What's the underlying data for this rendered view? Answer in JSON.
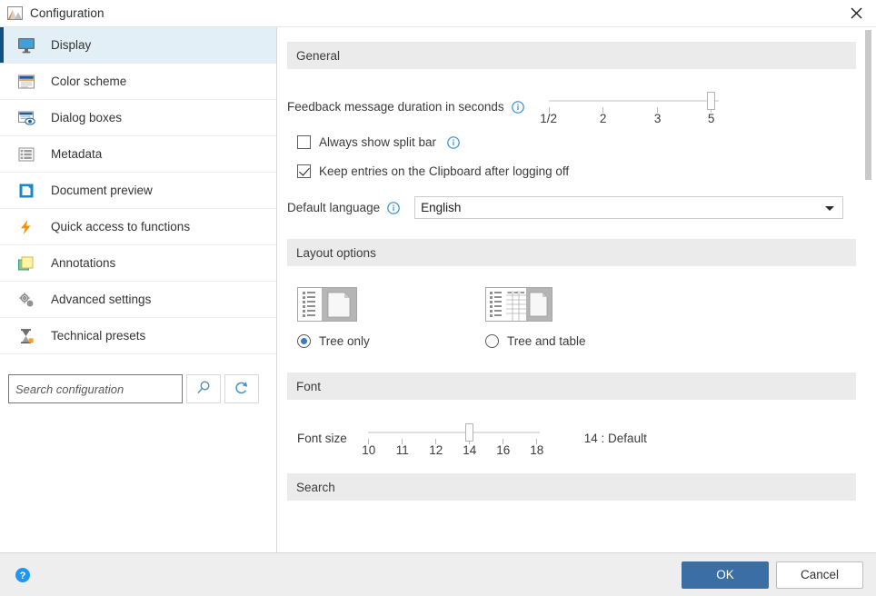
{
  "window": {
    "title": "Configuration",
    "icon": "app-image-icon",
    "close_label": "✕"
  },
  "sidebar": {
    "items": [
      {
        "label": "Display",
        "icon": "monitor-icon",
        "selected": true
      },
      {
        "label": "Color scheme",
        "icon": "color-scheme-icon",
        "selected": false
      },
      {
        "label": "Dialog boxes",
        "icon": "dialog-box-icon",
        "selected": false
      },
      {
        "label": "Metadata",
        "icon": "metadata-table-icon",
        "selected": false
      },
      {
        "label": "Document preview",
        "icon": "document-icon",
        "selected": false
      },
      {
        "label": "Quick access to functions",
        "icon": "lightning-bolt-icon",
        "selected": false
      },
      {
        "label": "Annotations",
        "icon": "sticky-notes-icon",
        "selected": false
      },
      {
        "label": "Advanced settings",
        "icon": "gears-icon",
        "selected": false
      },
      {
        "label": "Technical presets",
        "icon": "hourglass-icon",
        "selected": false
      }
    ],
    "search": {
      "placeholder": "Search configuration",
      "value": "",
      "search_icon": "magnifier-icon",
      "reset_icon": "refresh-icon"
    }
  },
  "content": {
    "sections": {
      "general": {
        "title": "General",
        "feedback_slider": {
          "label": "Feedback message duration in seconds",
          "info_icon": "info-icon",
          "ticks": [
            "1/2",
            "2",
            "3",
            "5"
          ],
          "value": "5",
          "value_index": 3
        },
        "split_bar": {
          "label": "Always show split bar",
          "checked": false,
          "info_icon": "info-icon"
        },
        "clipboard": {
          "label": "Keep entries on the Clipboard after logging off",
          "checked": true
        },
        "language": {
          "label": "Default language",
          "info_icon": "info-icon",
          "value": "English",
          "options": [
            "English"
          ]
        }
      },
      "layout": {
        "title": "Layout options",
        "options": [
          {
            "label": "Tree only",
            "selected": true,
            "preview": "tree-only-preview-icon"
          },
          {
            "label": "Tree and table",
            "selected": false,
            "preview": "tree-and-table-preview-icon"
          }
        ]
      },
      "font": {
        "title": "Font",
        "label": "Font size",
        "ticks": [
          "10",
          "11",
          "12",
          "14",
          "16",
          "18"
        ],
        "value": "14",
        "value_index": 3,
        "value_text": "14 : Default"
      },
      "search": {
        "title": "Search"
      }
    }
  },
  "footer": {
    "help_icon": "help-circle-icon",
    "ok_label": "OK",
    "cancel_label": "Cancel"
  },
  "colors": {
    "accent": "#3a6ea5",
    "selected_nav_bg": "#e3eff7",
    "selected_nav_bar": "#12507f",
    "section_header_bg": "#ebebeb",
    "footer_bg": "#eeeeee",
    "info_blue": "#2b8fd6"
  }
}
